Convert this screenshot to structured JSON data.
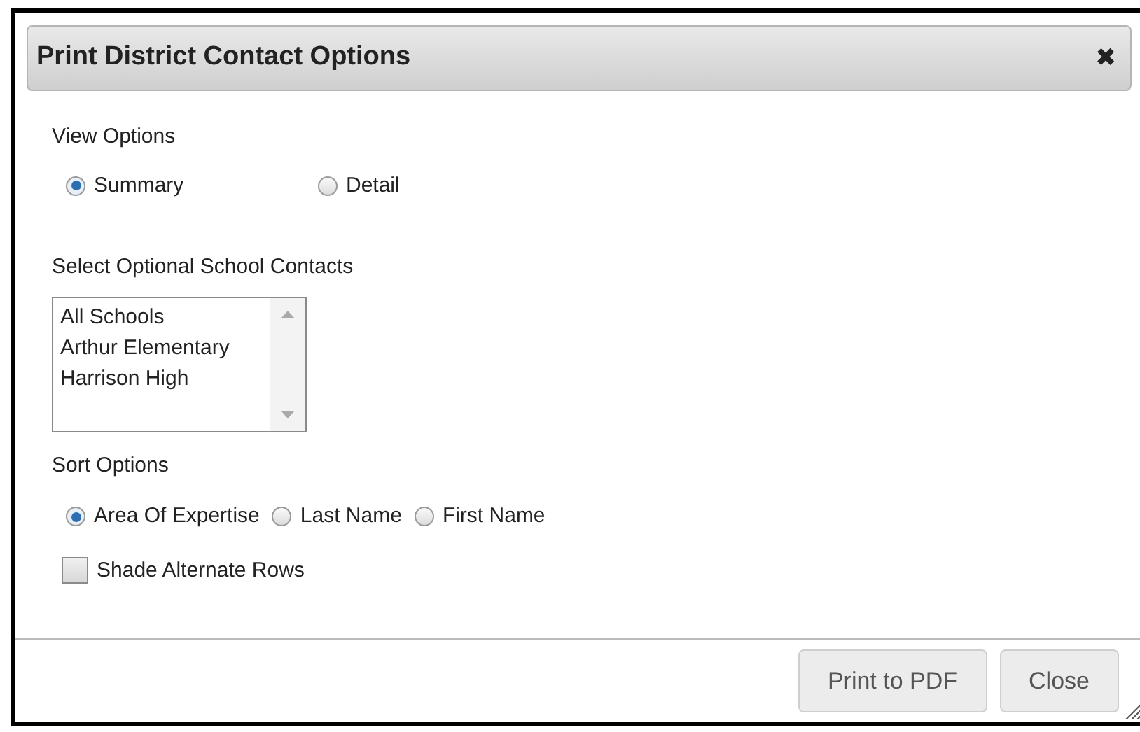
{
  "dialog": {
    "title": "Print District Contact Options",
    "close_icon": "✖"
  },
  "view_options": {
    "label": "View Options",
    "options": [
      {
        "label": "Summary",
        "selected": true
      },
      {
        "label": "Detail",
        "selected": false
      }
    ]
  },
  "school_contacts": {
    "label": "Select Optional School Contacts",
    "items": [
      "All Schools",
      "Arthur Elementary",
      "Harrison High"
    ]
  },
  "sort_options": {
    "label": "Sort Options",
    "options": [
      {
        "label": "Area Of Expertise",
        "selected": true
      },
      {
        "label": "Last Name",
        "selected": false
      },
      {
        "label": "First Name",
        "selected": false
      }
    ]
  },
  "shade_alternate_rows": {
    "label": "Shade Alternate Rows",
    "checked": false
  },
  "buttons": [
    "Print to PDF",
    "Close"
  ]
}
